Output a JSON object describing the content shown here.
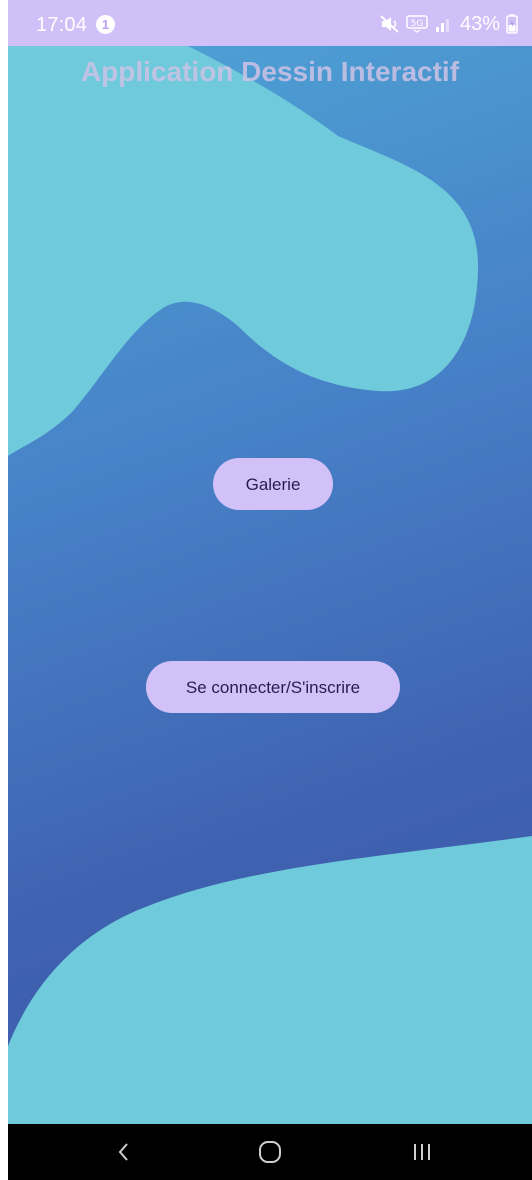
{
  "status_bar": {
    "time": "17:04",
    "notification_count": "1",
    "battery": "43%",
    "network_label": "5G"
  },
  "app": {
    "title": "Application Dessin Interactif"
  },
  "buttons": {
    "gallery": "Galerie",
    "login": "Se connecter/S'inscrire"
  },
  "nav_bar": {
    "icons": [
      "back-icon",
      "home-icon",
      "recent-apps-icon"
    ]
  },
  "colors": {
    "status_bar": "#d1bff8",
    "button_bg": "#d2c1f9",
    "button_text": "#2b1a52",
    "blob": "#6fcadb",
    "background_top": "#4fa4d6",
    "background_bottom": "#3c5aa8"
  }
}
